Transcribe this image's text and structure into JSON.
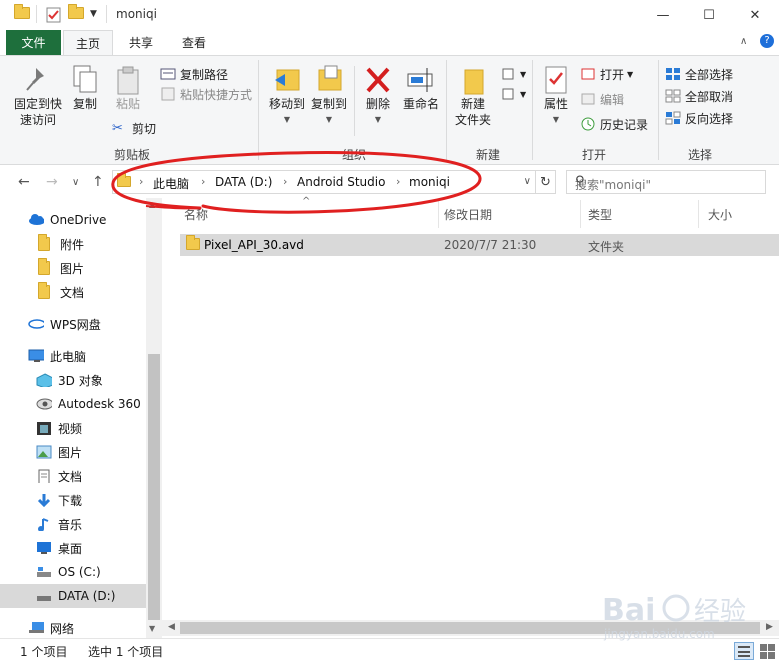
{
  "window": {
    "title": "moniqi",
    "minimize": "—",
    "maximize": "☐",
    "close": "✕"
  },
  "tabs": {
    "file": "文件",
    "home": "主页",
    "share": "共享",
    "view": "查看"
  },
  "ribbon": {
    "clipboard": {
      "pin": "固定到快\n速访问",
      "pin_l1": "固定到快",
      "pin_l2": "速访问",
      "copy": "复制",
      "paste": "粘贴",
      "cut": "剪切",
      "copy_path": "复制路径",
      "paste_shortcut": "粘贴快捷方式",
      "label": "剪贴板"
    },
    "organize": {
      "move_to": "移动到",
      "copy_to": "复制到",
      "delete": "删除",
      "rename": "重命名",
      "label": "组织"
    },
    "new": {
      "new_folder_l1": "新建",
      "new_folder_l2": "文件夹",
      "label": "新建"
    },
    "open": {
      "properties": "属性",
      "open": "打开",
      "edit": "编辑",
      "history": "历史记录",
      "label": "打开"
    },
    "select": {
      "select_all": "全部选择",
      "select_none": "全部取消",
      "invert": "反向选择",
      "label": "选择"
    }
  },
  "address": {
    "crumbs": [
      "此电脑",
      "DATA (D:)",
      "Android Studio",
      "moniqi"
    ],
    "search_placeholder": "搜索\"moniqi\""
  },
  "nav": {
    "items": [
      {
        "label": "OneDrive",
        "icon": "cloud-icon"
      },
      {
        "label": "附件",
        "icon": "folder-icon"
      },
      {
        "label": "图片",
        "icon": "folder-icon"
      },
      {
        "label": "文档",
        "icon": "folder-icon"
      },
      {
        "label": "WPS网盘",
        "icon": "cloud-icon"
      },
      {
        "label": "此电脑",
        "icon": "computer-icon"
      },
      {
        "label": "3D 对象",
        "icon": "cube-icon"
      },
      {
        "label": "Autodesk 360",
        "icon": "eye-icon"
      },
      {
        "label": "视频",
        "icon": "film-icon"
      },
      {
        "label": "图片",
        "icon": "picture-icon"
      },
      {
        "label": "文档",
        "icon": "document-icon"
      },
      {
        "label": "下载",
        "icon": "download-icon"
      },
      {
        "label": "音乐",
        "icon": "music-icon"
      },
      {
        "label": "桌面",
        "icon": "desktop-icon"
      },
      {
        "label": "OS (C:)",
        "icon": "drive-icon"
      },
      {
        "label": "DATA (D:)",
        "icon": "drive-icon"
      },
      {
        "label": "网络",
        "icon": "network-icon"
      }
    ]
  },
  "columns": {
    "name": "名称",
    "modified": "修改日期",
    "type": "类型",
    "size": "大小"
  },
  "files": [
    {
      "name": "Pixel_API_30.avd",
      "modified": "2020/7/7 21:30",
      "type": "文件夹",
      "size": ""
    }
  ],
  "status": {
    "count": "1 个项目",
    "selected": "选中 1 个项目"
  },
  "colors": {
    "file_tab": "#1e6f3c",
    "annotation": "#e02020",
    "selected_row": "#d9d9d9"
  }
}
